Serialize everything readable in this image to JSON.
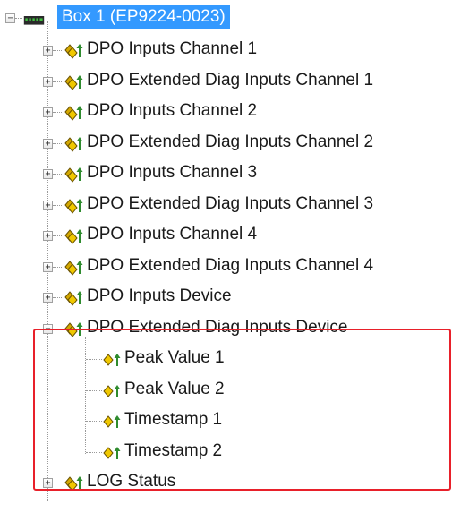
{
  "tree": {
    "root": {
      "label": "Box 1 (EP9224-0023)",
      "expanded": true,
      "selected": true
    },
    "children": [
      {
        "label": "DPO Inputs Channel 1",
        "expanded": false
      },
      {
        "label": "DPO Extended Diag Inputs Channel 1",
        "expanded": false
      },
      {
        "label": "DPO Inputs Channel 2",
        "expanded": false
      },
      {
        "label": "DPO Extended Diag Inputs Channel 2",
        "expanded": false
      },
      {
        "label": "DPO Inputs Channel 3",
        "expanded": false
      },
      {
        "label": "DPO Extended Diag Inputs Channel 3",
        "expanded": false
      },
      {
        "label": "DPO Inputs Channel 4",
        "expanded": false
      },
      {
        "label": "DPO Extended Diag Inputs Channel 4",
        "expanded": false
      },
      {
        "label": "DPO Inputs Device",
        "expanded": false
      },
      {
        "label": "DPO Extended Diag Inputs Device",
        "expanded": true
      },
      {
        "label": "LOG Status",
        "expanded": false
      }
    ],
    "device_items": [
      {
        "label": "Peak Value 1"
      },
      {
        "label": "Peak Value 2"
      },
      {
        "label": "Timestamp 1"
      },
      {
        "label": "Timestamp 2"
      }
    ]
  },
  "colors": {
    "selection_bg": "#3399ff",
    "highlight_border": "#e8202a",
    "icon_gold": "#e3b800",
    "icon_green": "#2e8b2e"
  },
  "icons": {
    "root": "ethercat-box-icon",
    "group": "input-group-icon",
    "variable": "input-variable-icon"
  }
}
